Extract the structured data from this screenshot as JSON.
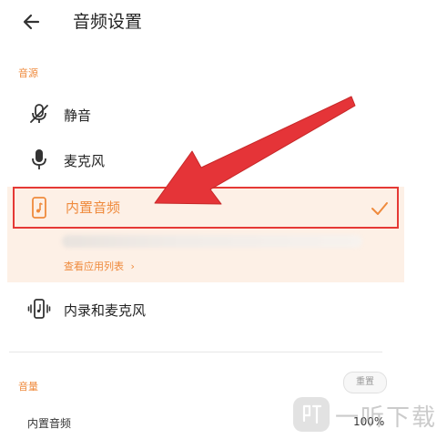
{
  "header": {
    "title": "音频设置",
    "back_icon": "arrow-left-icon"
  },
  "source_section": {
    "label": "音源",
    "options": [
      {
        "label": "静音",
        "icon": "mic-off-icon",
        "selected": false
      },
      {
        "label": "麦克风",
        "icon": "mic-icon",
        "selected": false
      },
      {
        "label": "内置音频",
        "icon": "phone-music-icon",
        "selected": true
      },
      {
        "label": "内录和麦克风",
        "icon": "phone-vibrate-icon",
        "selected": false
      }
    ],
    "view_apps_link": "查看应用列表",
    "link_chevron": "›"
  },
  "volume_section": {
    "label": "音量",
    "reset_label": "重置",
    "items": [
      {
        "label": "内置音频",
        "value": "100%"
      }
    ]
  },
  "watermark": {
    "text": "一听下载"
  },
  "colors": {
    "accent": "#ef8a3c",
    "highlight_border": "#e53935",
    "arrow": "#e53438",
    "selected_bg": "#fdf0e6"
  }
}
